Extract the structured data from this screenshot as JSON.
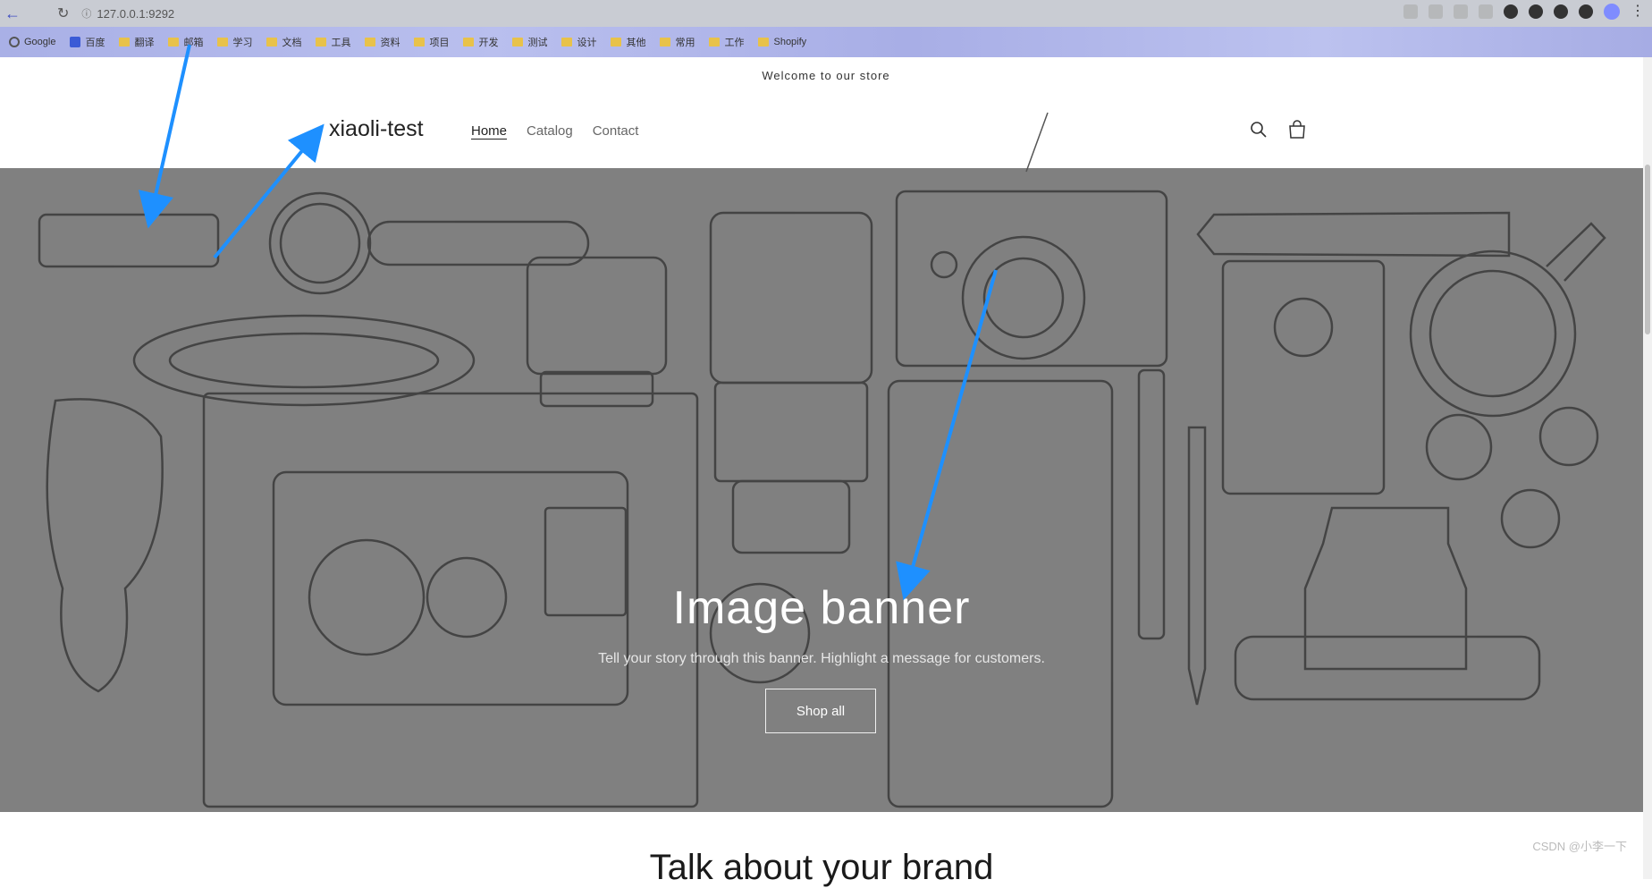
{
  "browser": {
    "back_glyph": "←",
    "reload_glyph": "↻",
    "address": "127.0.0.1:9292",
    "menu_glyph": "⋮"
  },
  "bookmarks": [
    {
      "label": "Google",
      "icon": "google-icon"
    },
    {
      "label": "百度",
      "icon": "baidu-icon"
    },
    {
      "label": "翻译",
      "icon": "folder-icon"
    },
    {
      "label": "邮箱",
      "icon": "folder-icon"
    },
    {
      "label": "学习",
      "icon": "folder-icon"
    },
    {
      "label": "文档",
      "icon": "folder-icon"
    },
    {
      "label": "工具",
      "icon": "folder-icon"
    },
    {
      "label": "资料",
      "icon": "folder-icon"
    },
    {
      "label": "项目",
      "icon": "folder-icon"
    },
    {
      "label": "开发",
      "icon": "folder-icon"
    },
    {
      "label": "测试",
      "icon": "folder-icon"
    },
    {
      "label": "设计",
      "icon": "folder-icon"
    },
    {
      "label": "其他",
      "icon": "folder-icon"
    },
    {
      "label": "常用",
      "icon": "folder-icon"
    },
    {
      "label": "工作",
      "icon": "folder-icon"
    },
    {
      "label": "Shopify",
      "icon": "folder-icon"
    }
  ],
  "store": {
    "announcement": "Welcome to our store",
    "logo": "xiaoli-test",
    "nav": {
      "home": "Home",
      "catalog": "Catalog",
      "contact": "Contact"
    },
    "banner": {
      "title": "Image banner",
      "subtitle": "Tell your story through this banner. Highlight a message for customers.",
      "button": "Shop all"
    },
    "brand_heading": "Talk about your brand",
    "watermark": "CSDN @小李一下"
  },
  "colors": {
    "banner_bg": "#808080",
    "annotation_arrow": "#1e90ff",
    "bookmark_bar": "#b1b7ea"
  }
}
